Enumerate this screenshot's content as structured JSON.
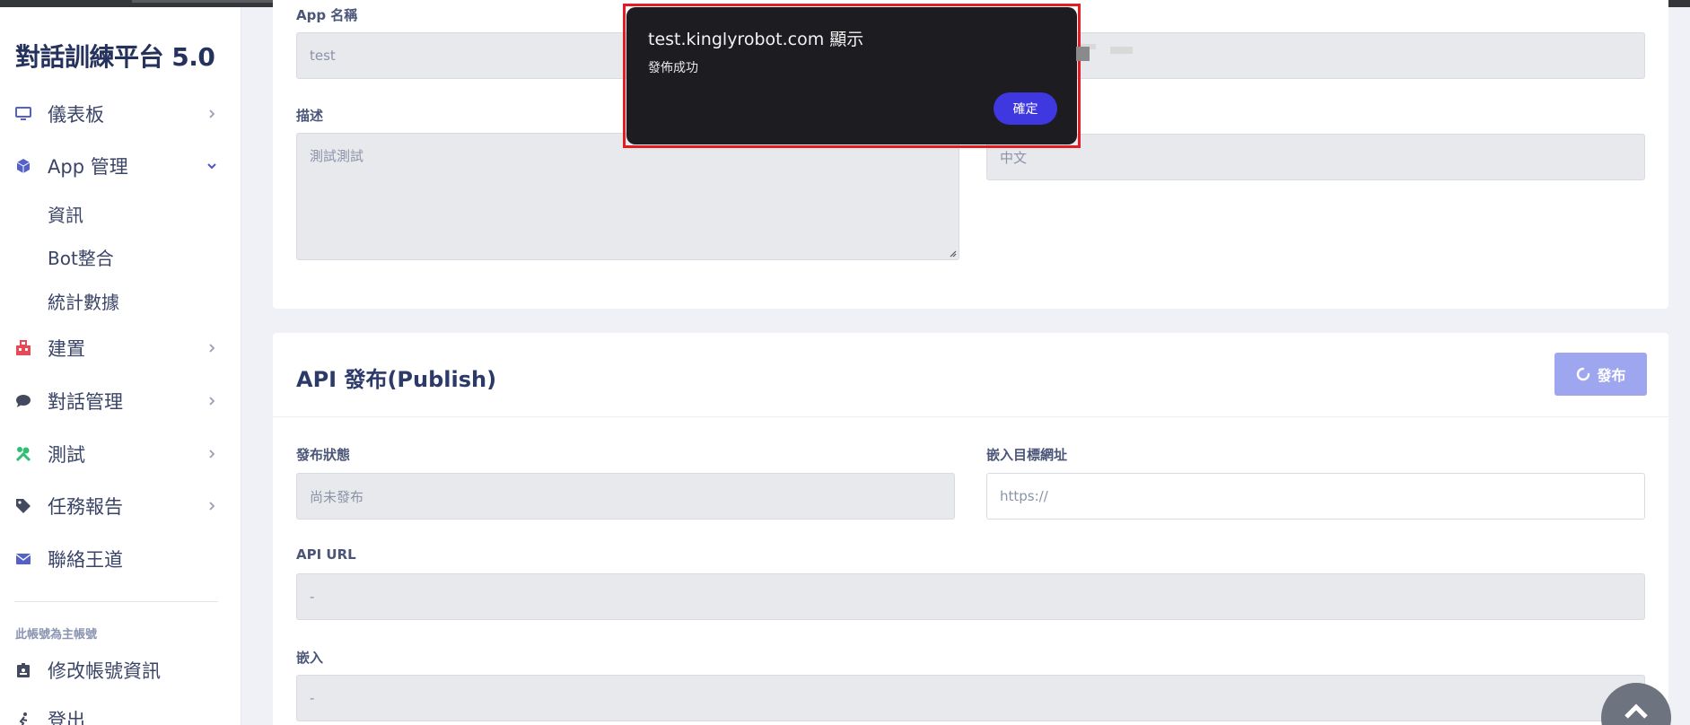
{
  "sidebar": {
    "brand": "對話訓練平台 5.0",
    "items": [
      {
        "label": "儀表板",
        "icon": "monitor-icon"
      },
      {
        "label": "App 管理",
        "icon": "cube-icon"
      },
      {
        "label": "建置",
        "icon": "build-icon"
      },
      {
        "label": "對話管理",
        "icon": "chat-icon"
      },
      {
        "label": "測試",
        "icon": "tools-icon"
      },
      {
        "label": "任務報告",
        "icon": "tag-icon"
      },
      {
        "label": "聯絡王道",
        "icon": "mail-icon"
      }
    ],
    "app_submenu": [
      "資訊",
      "Bot整合",
      "統計數據"
    ],
    "account_note": "此帳號為主帳號",
    "account_items": [
      {
        "label": "修改帳號資訊",
        "icon": "id-card-icon"
      },
      {
        "label": "登出",
        "icon": "logout-icon"
      }
    ]
  },
  "app_info": {
    "name_label": "App 名稱",
    "name_value": "test",
    "desc_label": "描述",
    "desc_value": "測試測試",
    "language_value": "中文"
  },
  "publish": {
    "title": "API 發布(Publish)",
    "button_label": "發布",
    "status_label": "發布狀態",
    "status_value": "尚未發布",
    "embed_target_label": "嵌入目標網址",
    "embed_target_placeholder": "https://",
    "api_url_label": "API URL",
    "api_url_value": "-",
    "embed_label": "嵌入",
    "embed_value": "-"
  },
  "dialog": {
    "title": "test.kinglyrobot.com 顯示",
    "message": "發佈成功",
    "ok_label": "確定"
  },
  "colors": {
    "brand": "#25325e",
    "accent": "#3f37e0",
    "publish_button": "#9ea6f0",
    "dialog_bg": "#1d1c21",
    "highlight": "#e31b23"
  }
}
